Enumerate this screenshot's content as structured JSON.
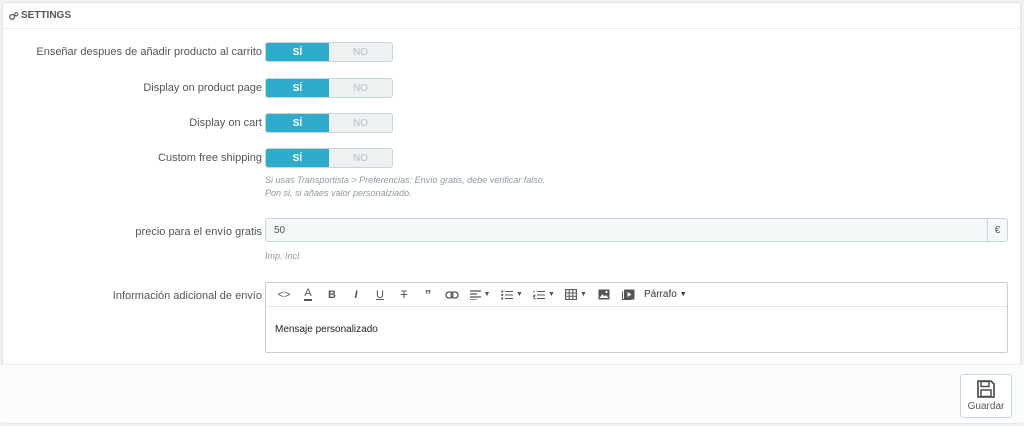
{
  "panel": {
    "title": "SETTINGS"
  },
  "switches": [
    {
      "label": "Enseñar despues de añadir producto al carrito",
      "on_label": "SÍ",
      "off_label": "NO",
      "state": "on"
    },
    {
      "label": "Display on product page",
      "on_label": "SÍ",
      "off_label": "NO",
      "state": "on"
    },
    {
      "label": "Display on cart",
      "on_label": "SÍ",
      "off_label": "NO",
      "state": "on"
    },
    {
      "label": "Custom free shipping",
      "on_label": "SÍ",
      "off_label": "NO",
      "state": "on"
    }
  ],
  "shipping_help": {
    "line1": "Si usas Transportista > Preferencias: Envío gratis, debe verificar falso.",
    "line2": "Pon si, si añaes valor personalziado."
  },
  "price": {
    "label": "precio para el envío gratis",
    "value": "50",
    "currency": "€",
    "help": "Imp. Incl."
  },
  "editor": {
    "label": "Información adicional de envío",
    "format_label": "Párrafo",
    "content": "Mensaje personalizado"
  },
  "footer": {
    "save_label": "Guardar"
  },
  "colors": {
    "accent": "#2eacce"
  }
}
